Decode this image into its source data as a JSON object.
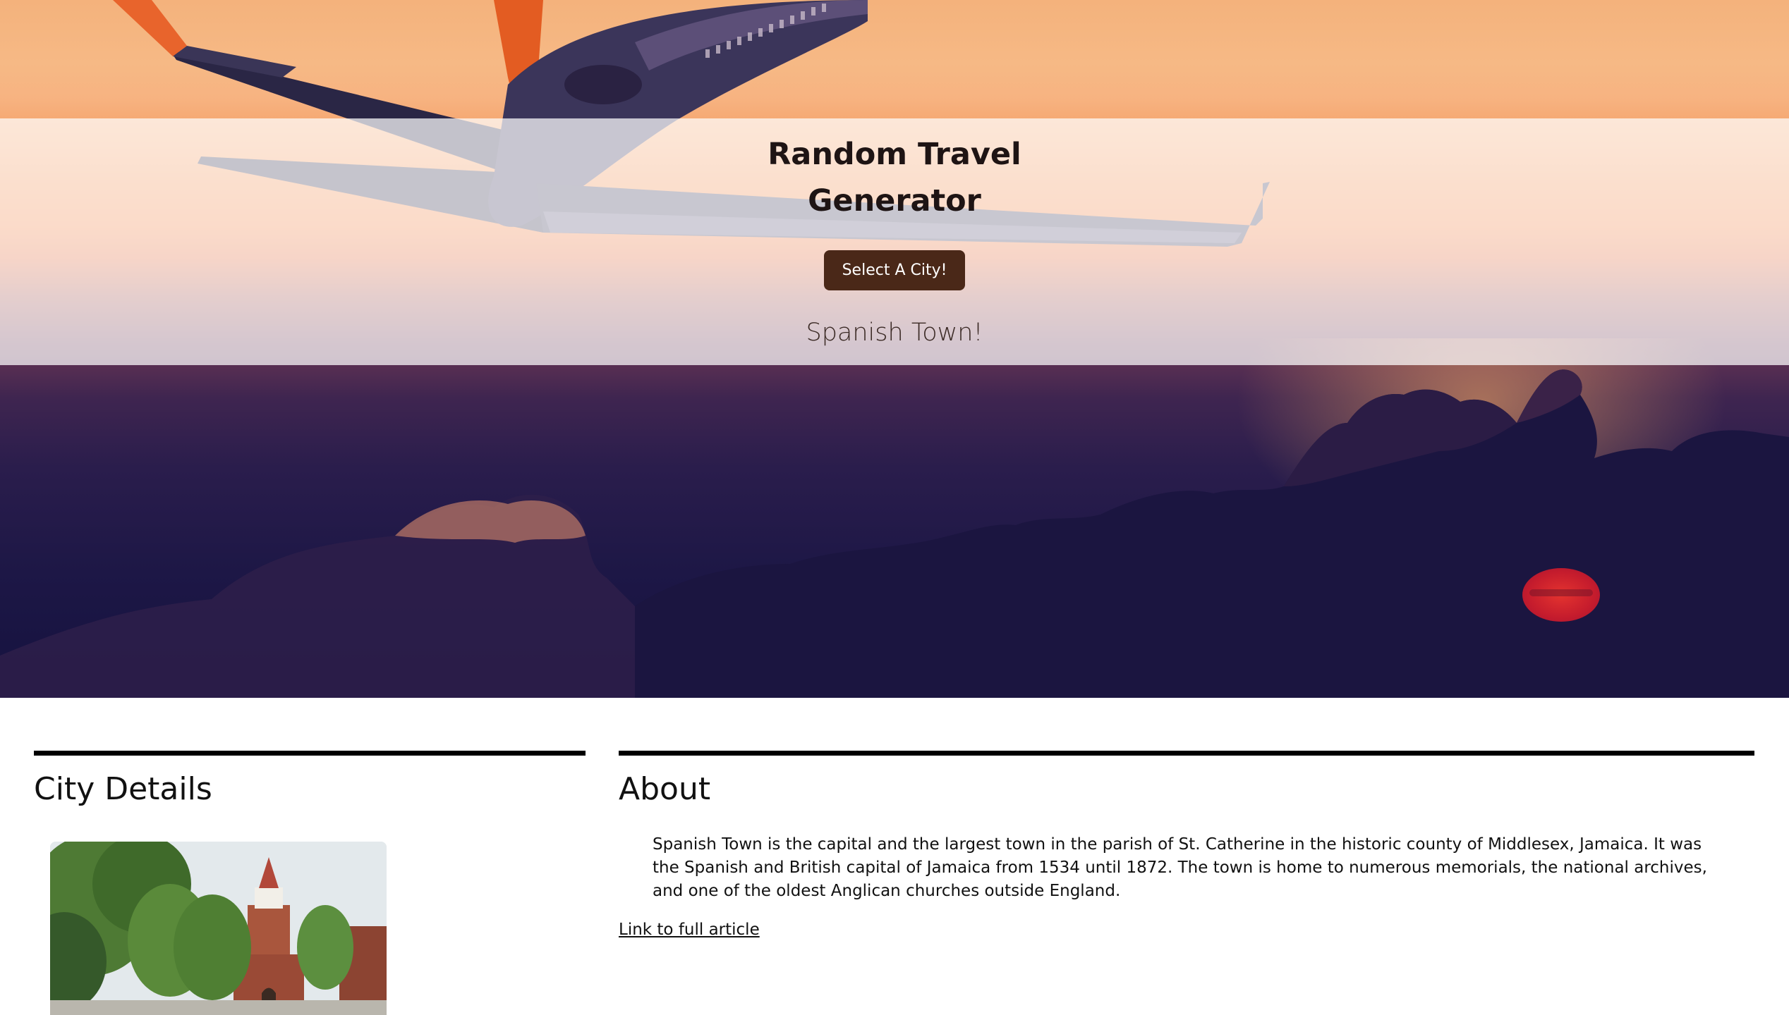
{
  "header": {
    "title_line1": "Random Travel",
    "title_line2": "Generator",
    "select_button_label": "Select A City!",
    "selected_city": "Spanish Town!"
  },
  "details": {
    "heading": "City Details",
    "photo_icon": "city-photo"
  },
  "about": {
    "heading": "About",
    "text": "Spanish Town is the capital and the largest town in the parish of St. Catherine in the historic county of Middlesex, Jamaica. It was the Spanish and British capital of Jamaica from 1534 until 1872. The town is home to numerous memorials, the national archives, and one of the oldest Anglican churches outside England.",
    "link_label": "Link to full article"
  },
  "colors": {
    "button_bg": "#4a2818",
    "rule": "#000000"
  }
}
